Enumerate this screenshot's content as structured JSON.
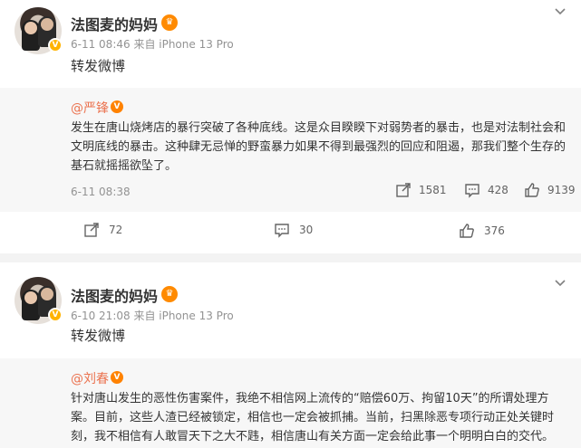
{
  "posts": [
    {
      "user": {
        "name": "法图麦的妈妈",
        "verified": "V"
      },
      "meta": "6-11 08:46 来自 iPhone 13 Pro",
      "text": "转发微博",
      "repost": {
        "author": "@严锋",
        "text": "发生在唐山烧烤店的暴行突破了各种底线。这是众目睽睽下对弱势者的暴击，也是对法制社会和文明底线的暴击。这种肆无忌惮的野蛮暴力如果不得到最强烈的回应和阻遏，那我们整个生存的基石就摇摇欲坠了。",
        "time": "6-11 08:38",
        "stats": {
          "reposts": "1581",
          "comments": "428",
          "likes": "9139"
        }
      },
      "actions": {
        "reposts": "72",
        "comments": "30",
        "likes": "376"
      }
    },
    {
      "user": {
        "name": "法图麦的妈妈",
        "verified": "V"
      },
      "meta": "6-10 21:08 来自 iPhone 13 Pro",
      "text": "转发微博",
      "repost": {
        "author": "@刘春",
        "text": "针对唐山发生的恶性伤害案件，我绝不相信网上流传的“赔偿60万、拘留10天”的所谓处理方案。目前，这些人渣已经被锁定，相信也一定会被抓捕。当前，扫黑除恶专项行动正处关键时刻，我不相信有人敢冒天下之大不韪，相信唐山有关方面一定会给此事一个明明白白的交代。"
      }
    }
  ],
  "colors": {
    "orange": "#ff8200",
    "link": "#eb7350",
    "gray": "#939393"
  }
}
